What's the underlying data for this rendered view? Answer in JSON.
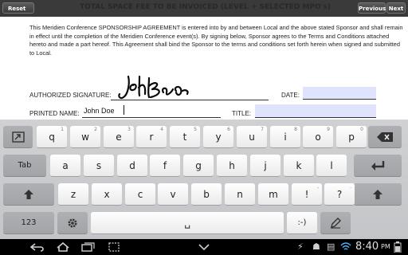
{
  "toolbar": {
    "reset_label": "Reset Field",
    "title": "TOTAL SPACE FEE TO BE INVOICED (LEVEL + SELECTED MPO's)",
    "dollar": "$",
    "prev_label": "Previous",
    "next_label": "Next"
  },
  "document": {
    "paragraph": "This Meridien Conference SPONSORSHIP AGREEMENT is entered into by and between Local and the above stated Sponsor and shall remain in effect until the completion of the Meridien Conference event(s). By signing below, Sponsor agrees to the Terms and Conditions attached hereto and made a part hereof. This Agreement shall bind the Sponsor to the terms and conditions set forth herein when signed and submitted to Local.",
    "authorized_signature_label": "AUTHORIZED SIGNATURE:",
    "date_label": "DATE:",
    "printed_name_label": "PRINTED NAME:",
    "printed_name_value": "John  Doe",
    "title_label": "TITLE:",
    "signature_alt": "John Doe",
    "field_color": "#dfe3fb"
  },
  "keyboard": {
    "row1": [
      {
        "key": "q",
        "sup": "1"
      },
      {
        "key": "w",
        "sup": "2"
      },
      {
        "key": "e",
        "sup": "3"
      },
      {
        "key": "r",
        "sup": "4"
      },
      {
        "key": "t",
        "sup": "5"
      },
      {
        "key": "y",
        "sup": "6"
      },
      {
        "key": "u",
        "sup": "7"
      },
      {
        "key": "i",
        "sup": "8"
      },
      {
        "key": "o",
        "sup": "9"
      },
      {
        "key": "p",
        "sup": "0"
      }
    ],
    "row2": [
      "a",
      "s",
      "d",
      "f",
      "g",
      "h",
      "j",
      "k",
      "l"
    ],
    "row3": [
      "z",
      "x",
      "c",
      "v",
      "b",
      "n",
      "m",
      "!",
      "?"
    ],
    "row3_sups": [
      "",
      "",
      "",
      "",
      "",
      "",
      "",
      ",",
      "."
    ],
    "tab_label": "Tab",
    "numbers_label": "123",
    "space_label": "␣",
    "colon_key": ":-)",
    "icons": {
      "tab_switch": "keyboard-switch-icon",
      "backspace": "backspace-icon",
      "enter": "enter-icon",
      "shift": "shift-icon",
      "settings": "gear-icon",
      "handwriting": "pen-icon"
    }
  },
  "status_bar": {
    "time": "8:40",
    "ampm": "PM",
    "icons": [
      "back-icon",
      "home-icon",
      "recent-apps-icon",
      "screenshot-icon",
      "keyboard-down-icon",
      "usb-icon",
      "android-debug-icon",
      "storage-icon",
      "wifi-icon",
      "battery-icon"
    ]
  }
}
